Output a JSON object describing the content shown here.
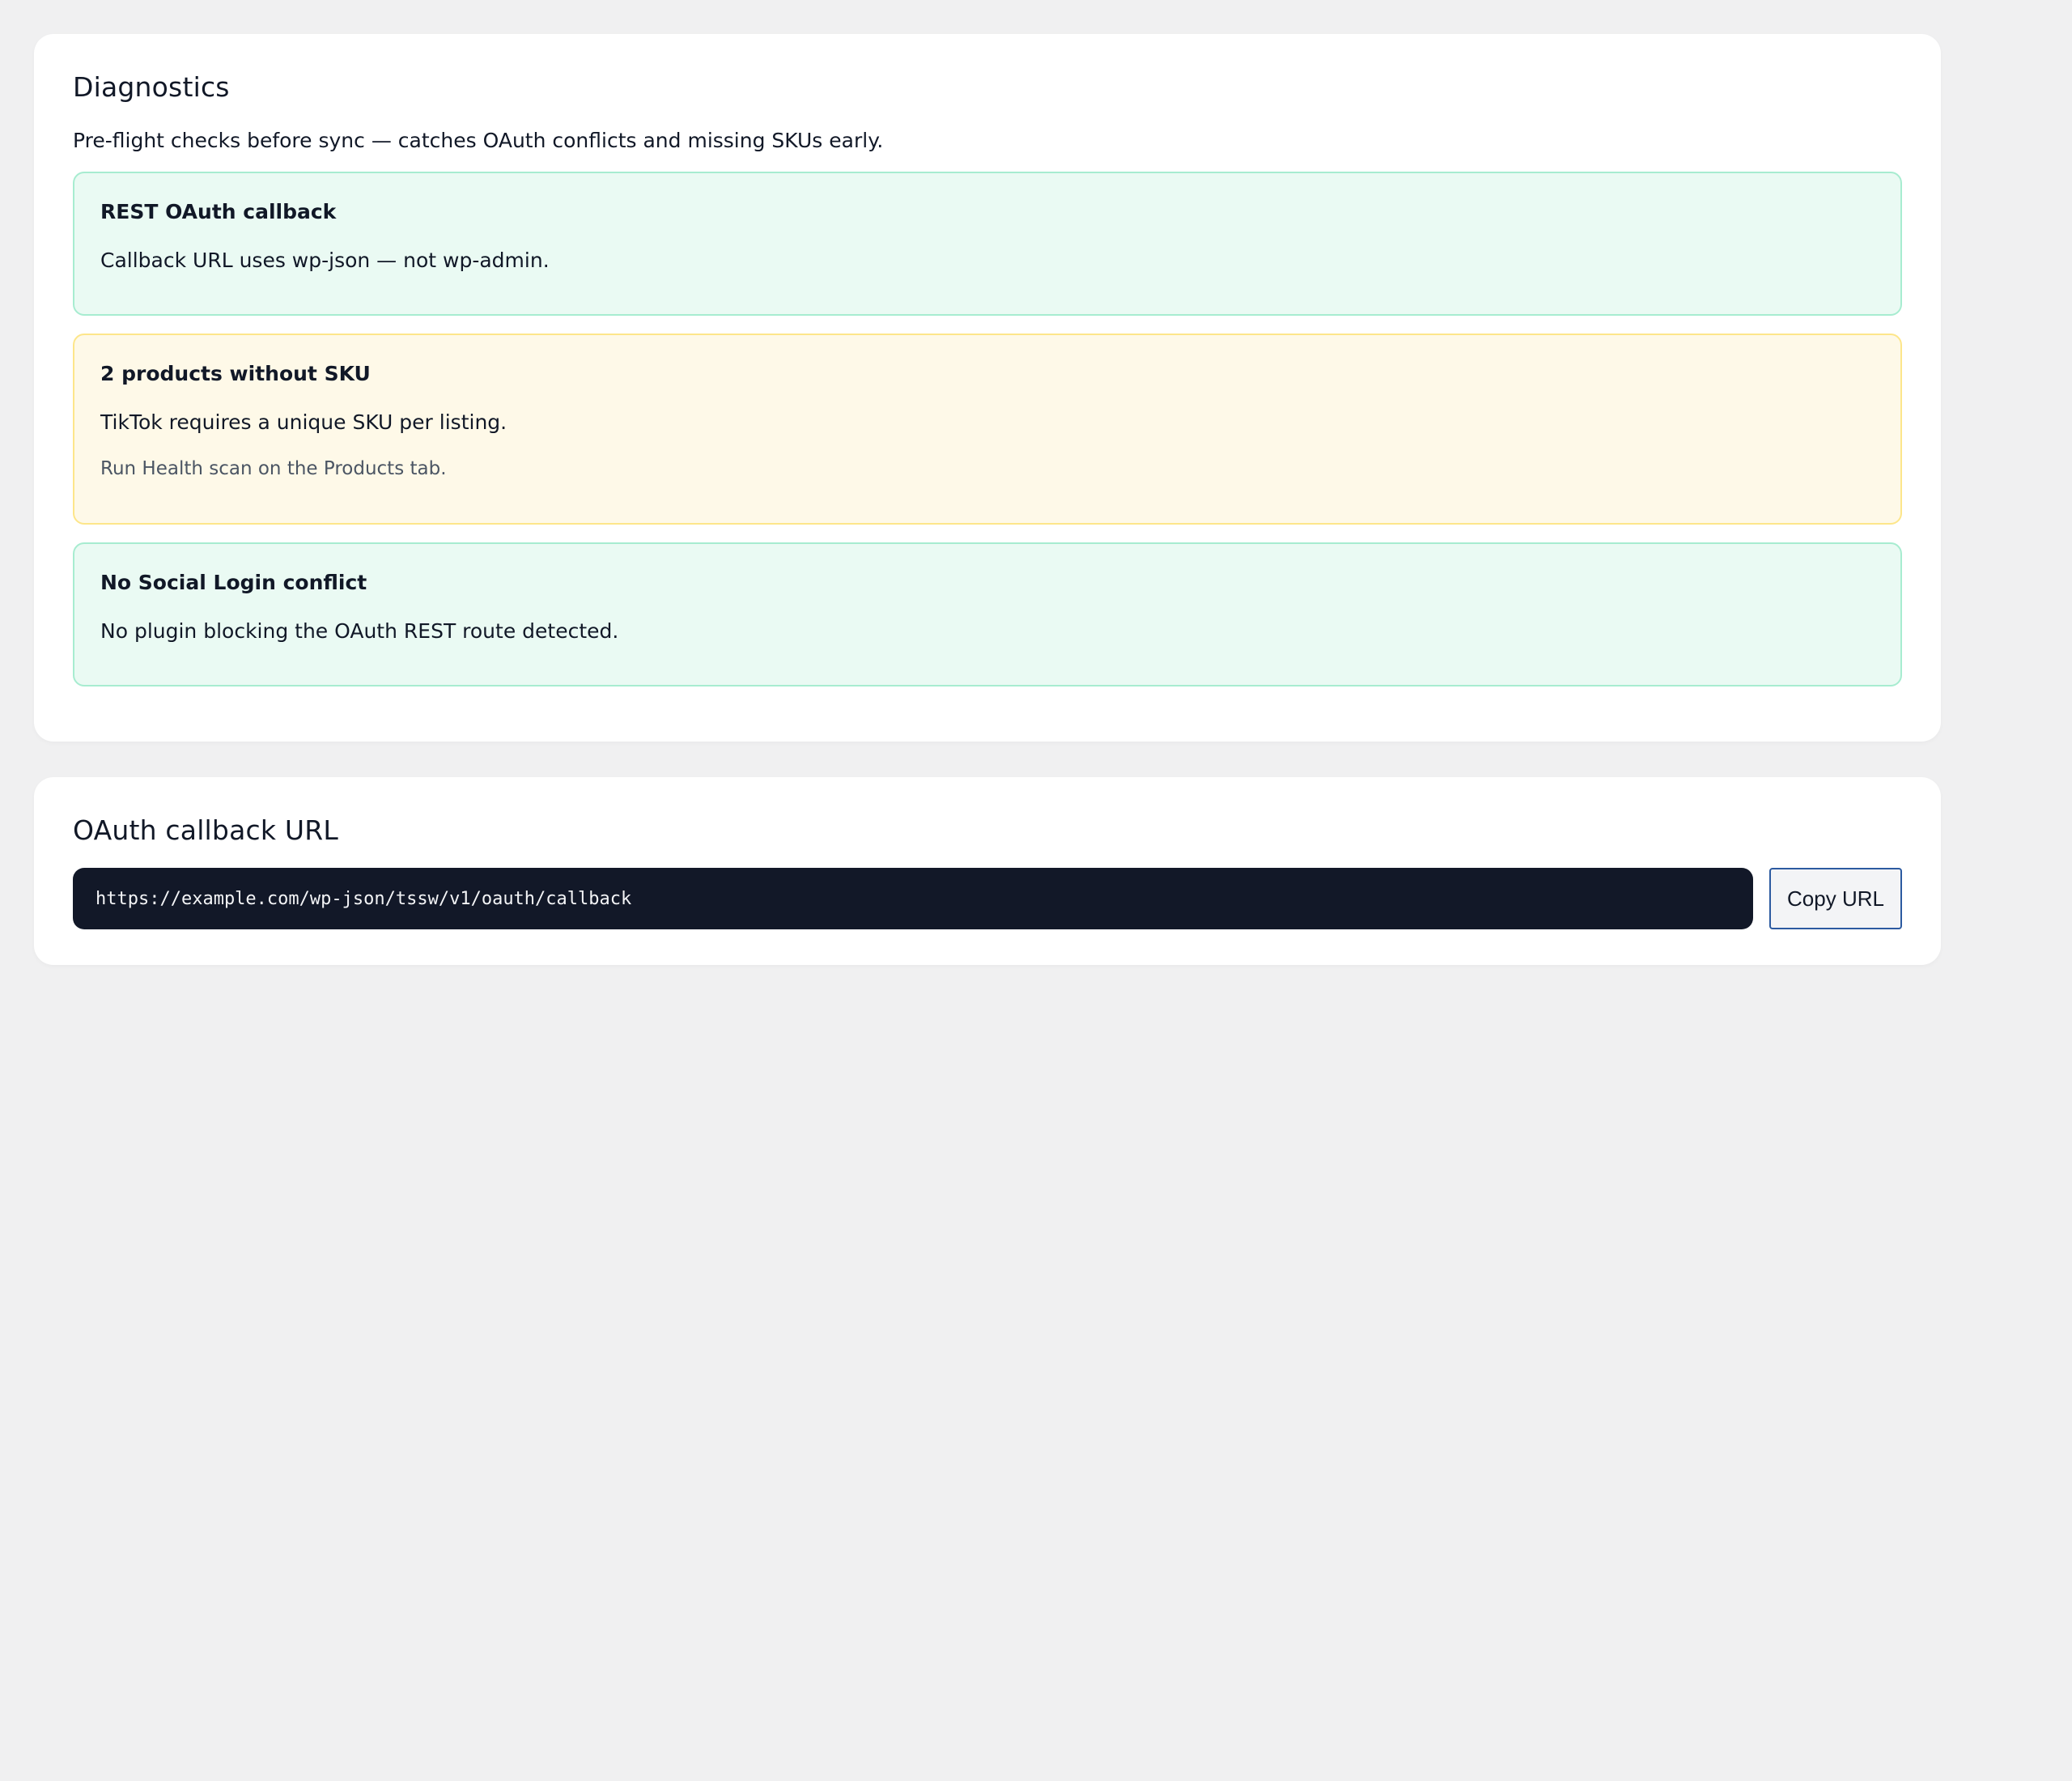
{
  "diagnostics": {
    "title": "Diagnostics",
    "description": "Pre-flight checks before sync — catches OAuth conflicts and missing SKUs early.",
    "checks": [
      {
        "status": "ok",
        "title": "REST OAuth callback",
        "message": "Callback URL uses wp-json — not wp-admin."
      },
      {
        "status": "warning",
        "title": "2 products without SKU",
        "message": "TikTok requires a unique SKU per listing.",
        "hint": "Run Health scan on the Products tab."
      },
      {
        "status": "ok",
        "title": "No Social Login conflict",
        "message": "No plugin blocking the OAuth REST route detected."
      }
    ]
  },
  "oauth": {
    "title": "OAuth callback URL",
    "url": "https://example.com/wp-json/tssw/v1/oauth/callback",
    "copy_label": "Copy URL"
  },
  "colors": {
    "page_background": "#f0f0f1",
    "ok_background": "#eafaf3",
    "ok_border": "#a7ecd0",
    "warning_background": "#fef9e8",
    "warning_border": "#fde68a",
    "url_box_background": "#121828",
    "button_border": "#2c5aa0"
  }
}
